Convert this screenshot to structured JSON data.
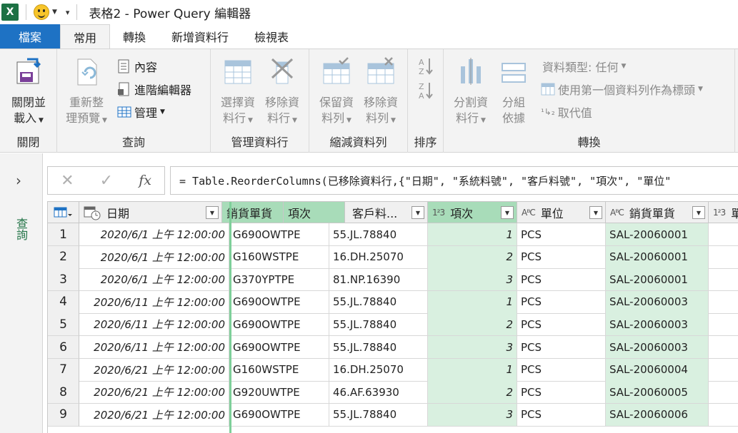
{
  "window": {
    "title": "表格2 - Power Query 編輯器",
    "app_badge": "X"
  },
  "tabs": [
    "檔案",
    "常用",
    "轉換",
    "新增資料行",
    "檢視表"
  ],
  "ribbon": {
    "close_load": {
      "line1": "關閉並",
      "line2": "載入"
    },
    "refresh": {
      "line1": "重新整",
      "line2": "理預覽"
    },
    "properties": "內容",
    "advanced_editor": "進階編輯器",
    "manage": "管理",
    "choose_cols": {
      "line1": "選擇資",
      "line2": "料行"
    },
    "remove_cols": {
      "line1": "移除資",
      "line2": "料行"
    },
    "keep_rows": {
      "line1": "保留資",
      "line2": "料列"
    },
    "remove_rows": {
      "line1": "移除資",
      "line2": "料列"
    },
    "split_col": {
      "line1": "分割資",
      "line2": "料行"
    },
    "group_by": {
      "line1": "分組",
      "line2": "依據"
    },
    "data_type": "資料類型: 任何",
    "use_first_row": "使用第一個資料列作為標頭",
    "replace_values": "取代值",
    "groups": {
      "close": "關閉",
      "query": "查詢",
      "manage_cols": "管理資料行",
      "reduce_rows": "縮減資料列",
      "sort": "排序",
      "transform": "轉換"
    }
  },
  "left_pane": {
    "label": "查詢"
  },
  "formula": "= Table.ReorderColumns(已移除資料行,{\"日期\", \"系統料號\", \"客戶料號\", \"項次\", \"單位\"",
  "columns": [
    {
      "label": "日期",
      "type": ""
    },
    {
      "label": "銷貨單貨",
      "type": ""
    },
    {
      "label": "項次",
      "type": ""
    },
    {
      "label": "客戶料...",
      "type": ""
    },
    {
      "label": "項次",
      "type": "1²3"
    },
    {
      "label": "單位",
      "type": "AᴮC"
    },
    {
      "label": "銷貨單貨",
      "type": "AᴮC"
    },
    {
      "label": "單",
      "type": "1²3"
    }
  ],
  "rows": [
    {
      "n": "1",
      "date": "2020/6/1 上午 12:00:00",
      "sys": "G690OWTPE",
      "cust": "55.JL.78840",
      "item": "1",
      "unit": "PCS",
      "sales": "SAL-20060001"
    },
    {
      "n": "2",
      "date": "2020/6/1 上午 12:00:00",
      "sys": "G160WSTPE",
      "cust": "16.DH.25070",
      "item": "2",
      "unit": "PCS",
      "sales": "SAL-20060001"
    },
    {
      "n": "3",
      "date": "2020/6/1 上午 12:00:00",
      "sys": "G370YPTPE",
      "cust": "81.NP.16390",
      "item": "3",
      "unit": "PCS",
      "sales": "SAL-20060001"
    },
    {
      "n": "4",
      "date": "2020/6/11 上午 12:00:00",
      "sys": "G690OWTPE",
      "cust": "55.JL.78840",
      "item": "1",
      "unit": "PCS",
      "sales": "SAL-20060003"
    },
    {
      "n": "5",
      "date": "2020/6/11 上午 12:00:00",
      "sys": "G690OWTPE",
      "cust": "55.JL.78840",
      "item": "2",
      "unit": "PCS",
      "sales": "SAL-20060003"
    },
    {
      "n": "6",
      "date": "2020/6/11 上午 12:00:00",
      "sys": "G690OWTPE",
      "cust": "55.JL.78840",
      "item": "3",
      "unit": "PCS",
      "sales": "SAL-20060003"
    },
    {
      "n": "7",
      "date": "2020/6/21 上午 12:00:00",
      "sys": "G160WSTPE",
      "cust": "16.DH.25070",
      "item": "1",
      "unit": "PCS",
      "sales": "SAL-20060004"
    },
    {
      "n": "8",
      "date": "2020/6/21 上午 12:00:00",
      "sys": "G920UWTPE",
      "cust": "46.AF.63930",
      "item": "2",
      "unit": "PCS",
      "sales": "SAL-20060005"
    },
    {
      "n": "9",
      "date": "2020/6/21 上午 12:00:00",
      "sys": "G690OWTPE",
      "cust": "55.JL.78840",
      "item": "3",
      "unit": "PCS",
      "sales": "SAL-20060006"
    }
  ],
  "colors": {
    "accent": "#1e72c4",
    "excel_green": "#217346",
    "selected_col": "#a8dcb9",
    "selected_cell": "#d9f0e0"
  }
}
